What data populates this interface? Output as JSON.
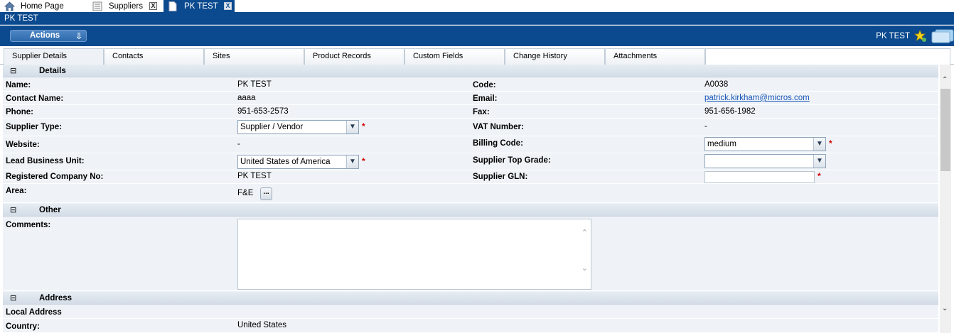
{
  "top_tabs": [
    {
      "label": "Home Page",
      "icon": "home-icon"
    },
    {
      "label": "Suppliers",
      "icon": "list-icon",
      "close": "X"
    },
    {
      "label": "PK TEST",
      "icon": "document-icon",
      "close": "X"
    }
  ],
  "title": "PK TEST",
  "actions": {
    "label": "Actions"
  },
  "header_right": {
    "name": "PK TEST"
  },
  "sub_tabs": [
    "Supplier Details",
    "Contacts",
    "Sites",
    "Product Records",
    "Custom Fields",
    "Change History",
    "Attachments"
  ],
  "sections": {
    "details": {
      "toggle": "⊟",
      "title": "Details"
    },
    "other": {
      "toggle": "⊟",
      "title": "Other"
    },
    "address": {
      "toggle": "⊟",
      "title": "Address"
    }
  },
  "details": {
    "name_label": "Name:",
    "name": "PK TEST",
    "contact_label": "Contact Name:",
    "contact": "aaaa",
    "phone_label": "Phone:",
    "phone": "951-653-2573",
    "supplier_type_label": "Supplier Type:",
    "supplier_type": "Supplier / Vendor",
    "website_label": "Website:",
    "website": "-",
    "lead_bu_label": "Lead Business Unit:",
    "lead_bu": "United States of America",
    "reg_no_label": "Registered Company No:",
    "reg_no": "PK TEST",
    "area_label": "Area:",
    "area": "F&E",
    "area_btn": "...",
    "code_label": "Code:",
    "code": "A0038",
    "email_label": "Email:",
    "email": "patrick.kirkham@micros.com",
    "fax_label": "Fax:",
    "fax": "951-656-1982",
    "vat_label": "VAT Number:",
    "vat": "-",
    "billing_label": "Billing Code:",
    "billing": "medium",
    "top_grade_label": "Supplier Top Grade:",
    "top_grade": "",
    "gln_label": "Supplier GLN:",
    "gln": "",
    "required_mark": "*"
  },
  "other": {
    "comments_label": "Comments:",
    "comments": ""
  },
  "address": {
    "local_label": "Local Address",
    "country_label": "Country:",
    "country": "United States"
  },
  "colors": {
    "brand_blue": "#0b4a8f",
    "link": "#1756b8",
    "required": "#d00000",
    "form_bg": "#eff3f7"
  }
}
